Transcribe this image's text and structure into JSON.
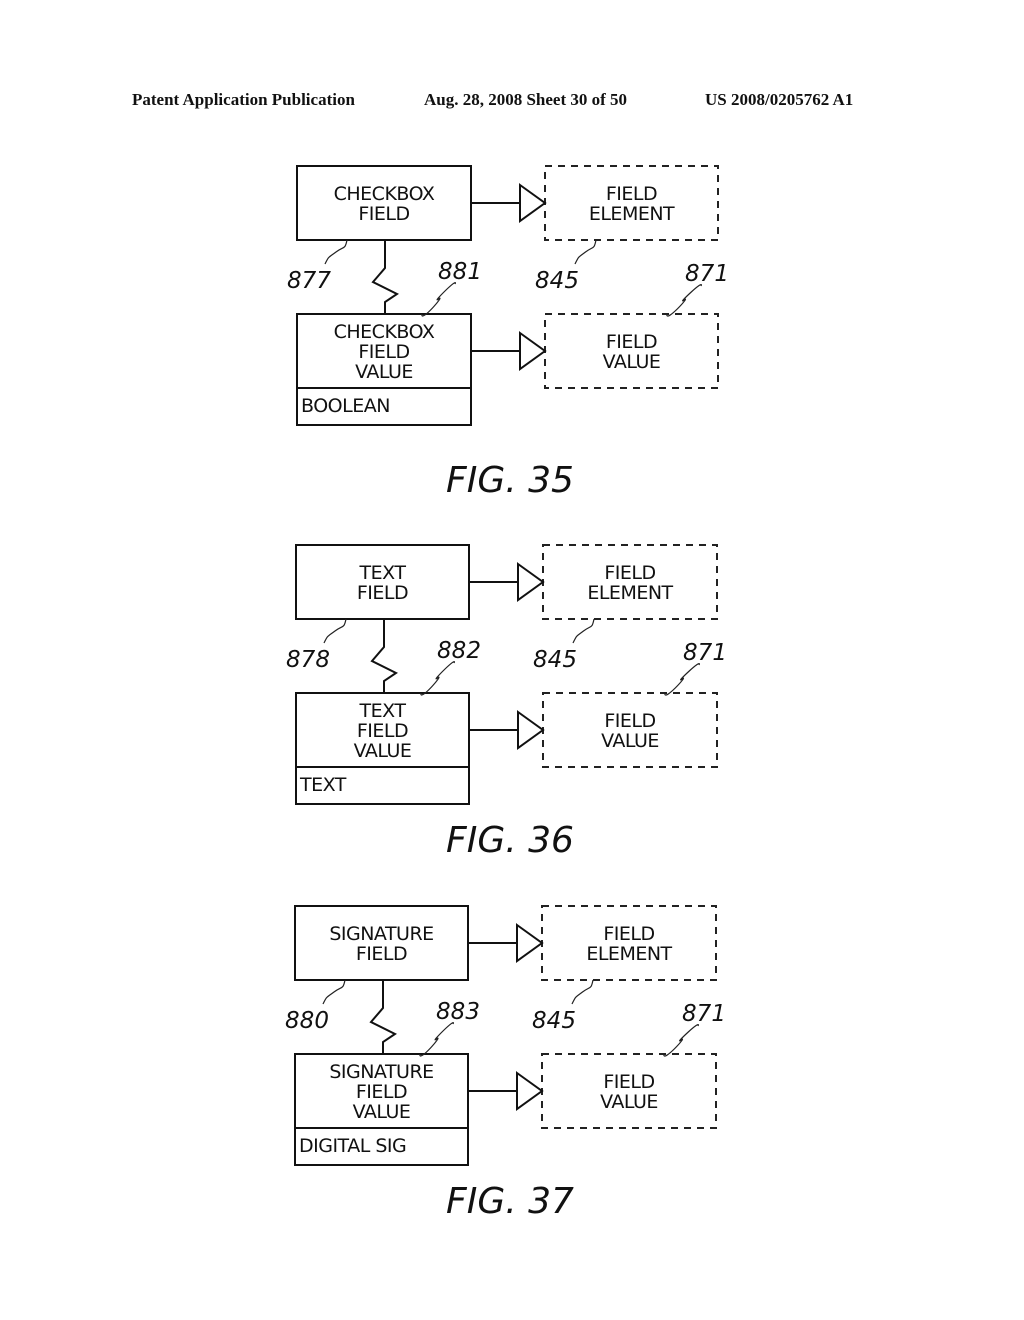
{
  "header": {
    "left": "Patent Application Publication",
    "middle": "Aug. 28, 2008  Sheet 30 of 50",
    "right": "US 2008/0205762 A1"
  },
  "figures": [
    {
      "caption": "FIG. 35",
      "field_box": [
        "CHECKBOX",
        "FIELD"
      ],
      "field_ref": "877",
      "value_box": [
        "CHECKBOX",
        "FIELD",
        "VALUE"
      ],
      "value_ref": "881",
      "value_type": "BOOLEAN",
      "element_box": [
        "FIELD",
        "ELEMENT"
      ],
      "element_ref": "845",
      "field_value_box": [
        "FIELD",
        "VALUE"
      ],
      "field_value_ref": "871"
    },
    {
      "caption": "FIG. 36",
      "field_box": [
        "TEXT",
        "FIELD"
      ],
      "field_ref": "878",
      "value_box": [
        "TEXT",
        "FIELD",
        "VALUE"
      ],
      "value_ref": "882",
      "value_type": "TEXT",
      "element_box": [
        "FIELD",
        "ELEMENT"
      ],
      "element_ref": "845",
      "field_value_box": [
        "FIELD",
        "VALUE"
      ],
      "field_value_ref": "871"
    },
    {
      "caption": "FIG. 37",
      "field_box": [
        "SIGNATURE",
        "FIELD"
      ],
      "field_ref": "880",
      "value_box": [
        "SIGNATURE",
        "FIELD",
        "VALUE"
      ],
      "value_ref": "883",
      "value_type": "DIGITAL SIG",
      "element_box": [
        "FIELD",
        "ELEMENT"
      ],
      "element_ref": "845",
      "field_value_box": [
        "FIELD",
        "VALUE"
      ],
      "field_value_ref": "871"
    }
  ]
}
